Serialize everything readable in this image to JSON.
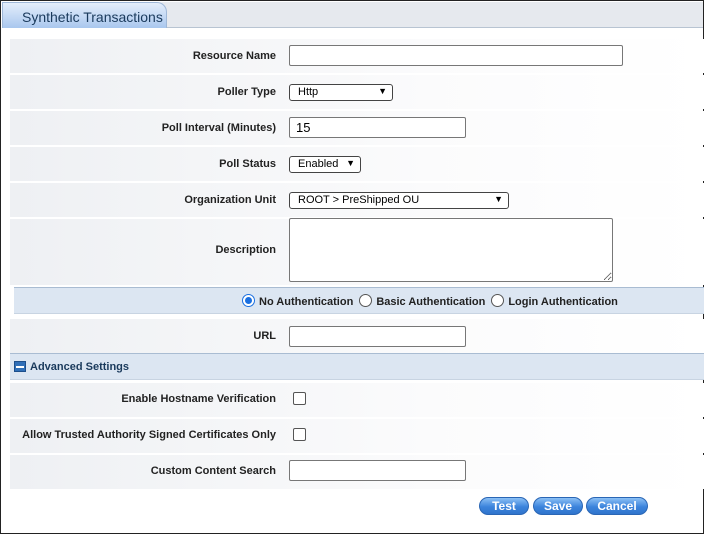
{
  "tab": {
    "title": "Synthetic Transactions"
  },
  "form": {
    "resource_name": {
      "label": "Resource Name",
      "value": ""
    },
    "poller_type": {
      "label": "Poller Type",
      "value": "Http"
    },
    "poll_interval": {
      "label": "Poll Interval (Minutes)",
      "value": "15"
    },
    "poll_status": {
      "label": "Poll Status",
      "value": "Enabled"
    },
    "org_unit": {
      "label": "Organization Unit",
      "value": "ROOT > PreShipped OU"
    },
    "description": {
      "label": "Description",
      "value": ""
    },
    "auth": {
      "options": [
        "No Authentication",
        "Basic Authentication",
        "Login Authentication"
      ],
      "selected": "No Authentication"
    },
    "url": {
      "label": "URL",
      "value": ""
    }
  },
  "advanced": {
    "title": "Advanced Settings",
    "icon": "collapse-minus-icon",
    "hostname_verification": {
      "label": "Enable Hostname Verification",
      "checked": false
    },
    "trusted_only": {
      "label": "Allow Trusted Authority Signed Certificates Only",
      "checked": false
    },
    "content_search": {
      "label": "Custom Content Search",
      "value": ""
    }
  },
  "buttons": {
    "test": "Test",
    "save": "Save",
    "cancel": "Cancel"
  }
}
